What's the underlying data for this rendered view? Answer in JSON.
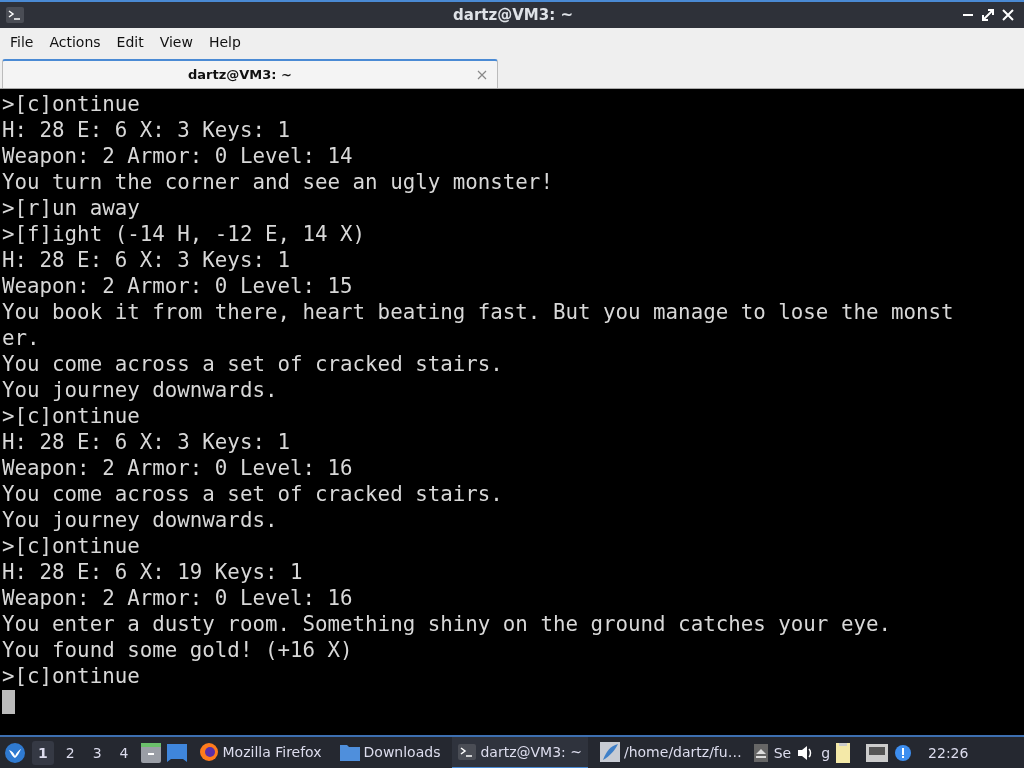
{
  "window": {
    "title": "dartz@VM3: ~"
  },
  "menu": [
    "File",
    "Actions",
    "Edit",
    "View",
    "Help"
  ],
  "tabs": [
    {
      "label": "dartz@VM3: ~",
      "selected": true
    }
  ],
  "terminal": {
    "lines": [
      ">[c]ontinue",
      "H: 28 E: 6 X: 3 Keys: 1",
      "Weapon: 2 Armor: 0 Level: 14",
      "You turn the corner and see an ugly monster!",
      ">[r]un away",
      ">[f]ight (-14 H, -12 E, 14 X)",
      "H: 28 E: 6 X: 3 Keys: 1",
      "Weapon: 2 Armor: 0 Level: 15",
      "You book it from there, heart beating fast. But you manage to lose the monst",
      "er.",
      "You come across a set of cracked stairs.",
      "You journey downwards.",
      ">[c]ontinue",
      "H: 28 E: 6 X: 3 Keys: 1",
      "Weapon: 2 Armor: 0 Level: 16",
      "You come across a set of cracked stairs.",
      "You journey downwards.",
      ">[c]ontinue",
      "H: 28 E: 6 X: 19 Keys: 1",
      "Weapon: 2 Armor: 0 Level: 16",
      "You enter a dusty room. Something shiny on the ground catches your eye.",
      "You found some gold! (+16 X)",
      ">[c]ontinue"
    ]
  },
  "taskbar": {
    "workspaces": [
      {
        "label": "1",
        "selected": true
      },
      {
        "label": "2",
        "selected": false
      },
      {
        "label": "3",
        "selected": false
      },
      {
        "label": "4",
        "selected": false
      }
    ],
    "tasks": [
      {
        "kind": "firefox",
        "label": "Mozilla Firefox",
        "selected": false
      },
      {
        "kind": "folder",
        "label": "Downloads",
        "selected": false
      },
      {
        "kind": "terminal",
        "label": "dartz@VM3: ~",
        "selected": true
      },
      {
        "kind": "editor",
        "label": "/home/dartz/fu…",
        "selected": false
      }
    ],
    "tray": [
      "Se",
      "g"
    ],
    "clock": "22:26"
  }
}
